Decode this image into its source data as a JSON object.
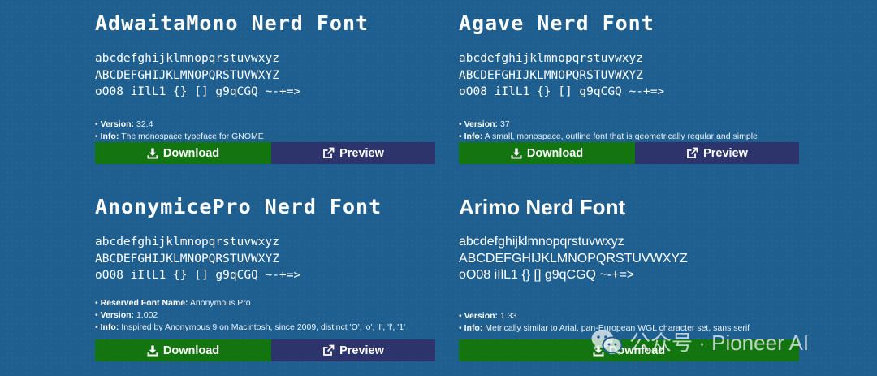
{
  "fonts": [
    {
      "title": "AdwaitaMono Nerd Font",
      "sample": [
        "abcdefghijklmnopqrstuvwxyz",
        "ABCDEFGHIJKLMNOPQRSTUVWXYZ",
        "oO08 iIlL1 {} [] g9qCGQ ~-+=>"
      ],
      "version_label": "Version:",
      "version": "32.4",
      "info_label": "Info:",
      "info": "The monospace typeface for GNOME",
      "download_label": "Download",
      "preview_label": "Preview"
    },
    {
      "title": "Agave Nerd Font",
      "sample": [
        "abcdefghijklmnopqrstuvwxyz",
        "ABCDEFGHIJKLMNOPQRSTUVWXYZ",
        "oO08 iIlL1 {} [] g9qCGQ ~-+=>"
      ],
      "version_label": "Version:",
      "version": "37",
      "info_label": "Info:",
      "info": "A small, monospace, outline font that is geometrically regular and simple",
      "download_label": "Download",
      "preview_label": "Preview"
    },
    {
      "title": "AnonymicePro Nerd Font",
      "sample": [
        "abcdefghijklmnopqrstuvwxyz",
        "ABCDEFGHIJKLMNOPQRSTUVWXYZ",
        "oO08 iIlL1 {} [] g9qCGQ ~-+=>"
      ],
      "reserved_label": "Reserved Font Name:",
      "reserved": "Anonymous Pro",
      "version_label": "Version:",
      "version": "1.002",
      "info_label": "Info:",
      "info": "Inspired by Anonymous 9 on Macintosh, since 2009, distinct 'O', 'o', 'I', 'l', '1'",
      "download_label": "Download",
      "preview_label": "Preview"
    },
    {
      "title": "Arimo Nerd Font",
      "sample": [
        "abcdefghijklmnopqrstuvwxyz",
        "ABCDEFGHIJKLMNOPQRSTUVWXYZ",
        "oO08 iIlL1 {} [] g9qCGQ ~-+=>"
      ],
      "version_label": "Version:",
      "version": "1.33",
      "info_label": "Info:",
      "info": "Metrically similar to Arial, pan-European WGL character set, sans serif",
      "download_label": "Download"
    }
  ],
  "bullet": "•",
  "icons": {
    "download": "download-icon",
    "preview": "external-link-icon",
    "watermark": "wechat-icon"
  },
  "colors": {
    "background": "#1f5f8f",
    "download_button": "#137510",
    "preview_button": "#2d336b"
  },
  "watermark": {
    "text": "公众号 · Pioneer AI"
  }
}
